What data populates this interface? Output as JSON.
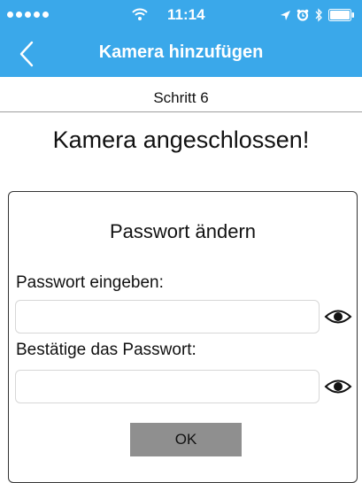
{
  "status_bar": {
    "time": "11:14"
  },
  "nav": {
    "title": "Kamera hinzufügen"
  },
  "step_label": "Schritt 6",
  "headline": "Kamera angeschlossen!",
  "dialog": {
    "title": "Passwort ändern",
    "password_label": "Passwort eingeben:",
    "password_value": "",
    "confirm_label": "Bestätige das Passwort:",
    "confirm_value": "",
    "ok_label": "OK"
  },
  "colors": {
    "accent": "#3aa8ea",
    "button": "#8f8f8f"
  },
  "icons": {
    "back": "chevron-left-icon",
    "show_password": "eye-icon"
  }
}
